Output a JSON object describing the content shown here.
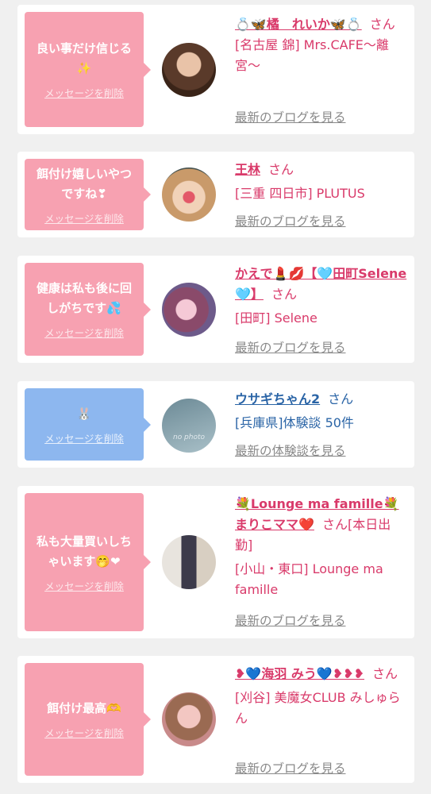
{
  "cards": [
    {
      "message": "良い事だけ信じる✨",
      "delete_label": "メッセージを削除",
      "name": "💍🦋橘　れいか🦋💍",
      "san": "さん",
      "shop": "[名古屋 錦] Mrs.CAFE〜離宮〜",
      "link": "最新のブログを見る"
    },
    {
      "message": "餌付け嬉しいやつですね❣",
      "delete_label": "メッセージを削除",
      "name": "王林",
      "san": "さん",
      "shop": "[三重 四日市] PLUTUS",
      "link": "最新のブログを見る"
    },
    {
      "message": "健康は私も後に回しがちです💦",
      "delete_label": "メッセージを削除",
      "name": "かえで💄💋【🩵田町Selene🩵】",
      "san": "さん",
      "shop": "[田町] Selene",
      "link": "最新のブログを見る"
    },
    {
      "message": "🐰",
      "delete_label": "メッセージを削除",
      "name": "ウサギちゃん2",
      "san": "さん",
      "shop": "[兵庫県]体験談 50件",
      "link": "最新の体験談を見る",
      "avatar_text": "no photo"
    },
    {
      "message": "私も大量買いしちゃいます🤭❤",
      "delete_label": "メッセージを削除",
      "name": "💐Lounge ma famille💐まりこママ❤️",
      "san": "さん",
      "san_suffix": "[本日出勤]",
      "shop": "[小山・東口] Lounge ma famille",
      "link": "最新のブログを見る"
    },
    {
      "message": "餌付け最高🫶",
      "delete_label": "メッセージを削除",
      "name": "❥💙海羽 みう💙❥❥❥",
      "san": "さん",
      "shop": "[刈谷] 美魔女CLUB みしゅらん",
      "link": "最新のブログを見る"
    }
  ],
  "colors": {
    "pink_bubble": "#f7a1b1",
    "blue_bubble": "#8db7ef",
    "pink_text": "#d93a6a",
    "blue_text": "#2a64a6"
  }
}
